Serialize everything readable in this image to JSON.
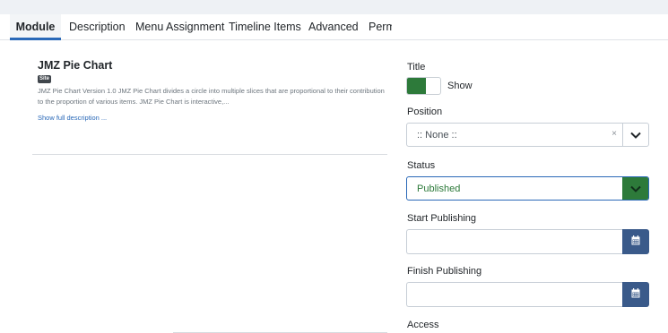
{
  "tabs": [
    {
      "label": "Module",
      "active": true
    },
    {
      "label": "Description",
      "active": false
    },
    {
      "label": "Menu Assignment",
      "active": false
    },
    {
      "label": "Timeline Items",
      "active": false
    },
    {
      "label": "Advanced",
      "active": false
    },
    {
      "label": "Permissions",
      "active": false
    }
  ],
  "module": {
    "title": "JMZ Pie Chart",
    "badge": "Site",
    "description": "JMZ Pie Chart Version 1.0 JMZ Pie Chart divides a circle into multiple slices that are proportional to their contribution to the proportion of various items. JMZ Pie Chart is interactive,...",
    "show_more": "Show full description ..."
  },
  "title_field": {
    "label": "Title",
    "toggle_text": "Show",
    "toggle_on": true,
    "on_color": "#2d7a3a"
  },
  "position": {
    "label": "Position",
    "value": ":: None ::",
    "clear_glyph": "×",
    "icon": "chevron-down-icon"
  },
  "status": {
    "label": "Status",
    "value": "Published",
    "color": "#2d7a3a",
    "icon": "chevron-down-icon"
  },
  "start_publishing": {
    "label": "Start Publishing",
    "value": "",
    "icon": "calendar-icon"
  },
  "finish_publishing": {
    "label": "Finish Publishing",
    "value": "",
    "icon": "calendar-icon"
  },
  "access": {
    "label": "Access"
  },
  "colors": {
    "accent": "#2a69b8",
    "published": "#2d7a3a",
    "calendar_button": "#3a5a8a"
  }
}
